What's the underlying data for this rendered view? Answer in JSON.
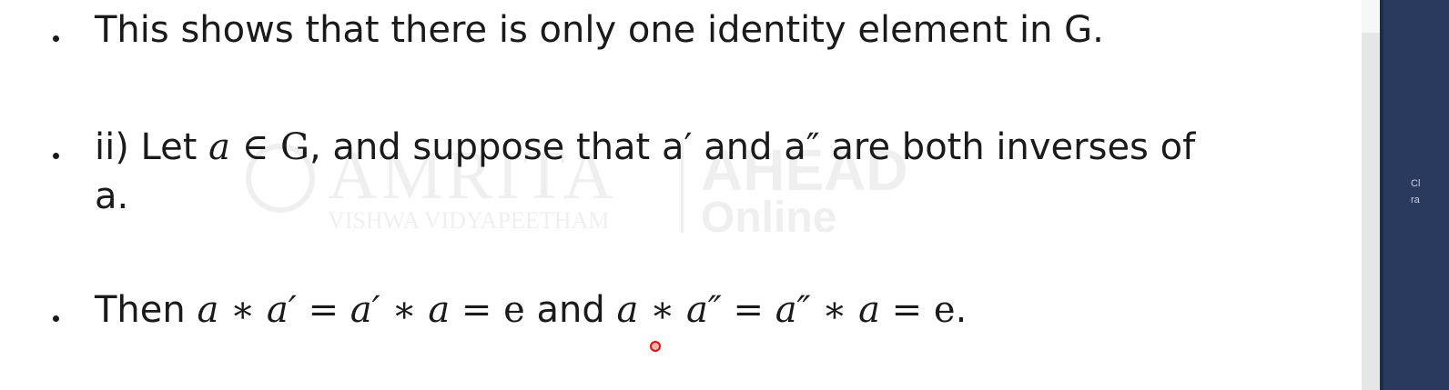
{
  "slide": {
    "watermark": {
      "brand": "AMRITA",
      "sub": "VISHWA VIDYAPEETHAM",
      "right_top": "AHEAD",
      "right_bottom": "Online"
    },
    "bullets": [
      {
        "segments": [
          {
            "type": "text",
            "value": "This shows that there is only one identity element in G."
          }
        ]
      },
      {
        "segments": [
          {
            "type": "text",
            "value": "ii) Let "
          },
          {
            "type": "math",
            "value": "a"
          },
          {
            "type": "text",
            "value": " "
          },
          {
            "type": "upright",
            "value": "∈ G"
          },
          {
            "type": "text",
            "value": ", and suppose that a′ and a″ are both inverses of\na."
          }
        ]
      },
      {
        "segments": [
          {
            "type": "text",
            "value": "Then "
          },
          {
            "type": "math",
            "value": "a ∗ a′ = a′ ∗ a = "
          },
          {
            "type": "upright",
            "value": "e"
          },
          {
            "type": "text",
            "value": " and "
          },
          {
            "type": "math",
            "value": "a ∗ a″ = a″ ∗ a = "
          },
          {
            "type": "upright",
            "value": "e"
          },
          {
            "type": "text",
            "value": "."
          }
        ]
      }
    ]
  },
  "side_panel": {
    "line1": "Cl",
    "line2": "ra"
  },
  "colors": {
    "text": "#1a1a1a",
    "cursor": "#e01010",
    "side_panel": "#2a3a5e",
    "scrollbar": "#e6e6e6"
  }
}
